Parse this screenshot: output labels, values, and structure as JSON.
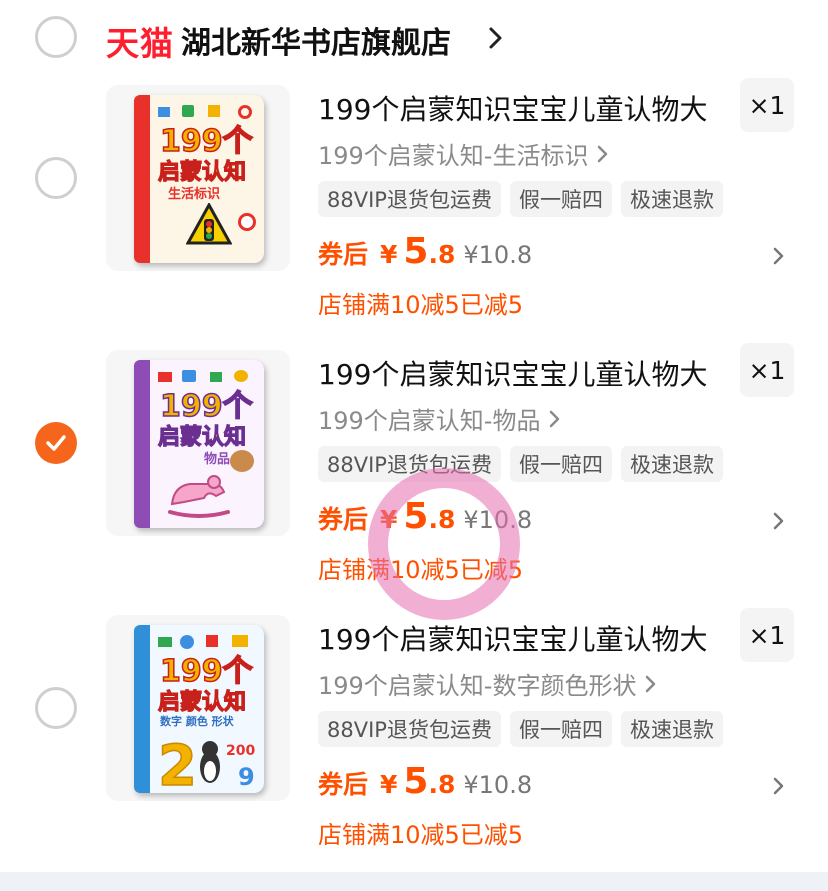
{
  "store": {
    "logo": "天猫",
    "name": "湖北新华书店旗舰店"
  },
  "items": [
    {
      "title": "199个启蒙知识宝宝儿童认物大",
      "qty": "×1",
      "sku": "199个启蒙认知-生活标识",
      "tags": [
        "88VIP退货包运费",
        "假一赔四",
        "极速退款"
      ],
      "price_label": "券后",
      "currency": "¥",
      "price_int": "5",
      "price_dec": ".8",
      "orig_price": "¥10.8",
      "promo": "店铺满10减5已减5",
      "selected": false,
      "cover": {
        "big": "199个",
        "line": "启蒙认知",
        "sub": "生活标识",
        "accent": "#e8312a",
        "bg": "#fdf5e6"
      }
    },
    {
      "title": "199个启蒙知识宝宝儿童认物大",
      "qty": "×1",
      "sku": "199个启蒙认知-物品",
      "tags": [
        "88VIP退货包运费",
        "假一赔四",
        "极速退款"
      ],
      "price_label": "券后",
      "currency": "¥",
      "price_int": "5",
      "price_dec": ".8",
      "orig_price": "¥10.8",
      "promo": "店铺满10减5已减5",
      "selected": true,
      "cover": {
        "big": "199个",
        "line": "启蒙认知",
        "sub": "物品",
        "accent": "#8e4db5",
        "bg": "#fbf4ff"
      }
    },
    {
      "title": "199个启蒙知识宝宝儿童认物大",
      "qty": "×1",
      "sku": "199个启蒙认知-数字颜色形状",
      "tags": [
        "88VIP退货包运费",
        "假一赔四",
        "极速退款"
      ],
      "price_label": "券后",
      "currency": "¥",
      "price_int": "5",
      "price_dec": ".8",
      "orig_price": "¥10.8",
      "promo": "店铺满10减5已减5",
      "selected": false,
      "cover": {
        "big": "199个",
        "line": "启蒙认知",
        "sub": "数字 颜色 形状",
        "accent": "#2f8fd8",
        "bg": "#f1f8ff"
      }
    }
  ],
  "colors": {
    "accent": "#ff5000",
    "tmall_red": "#ff1e2e",
    "radio_checked": "#f5661c",
    "tag_bg": "#f3f3f3"
  }
}
